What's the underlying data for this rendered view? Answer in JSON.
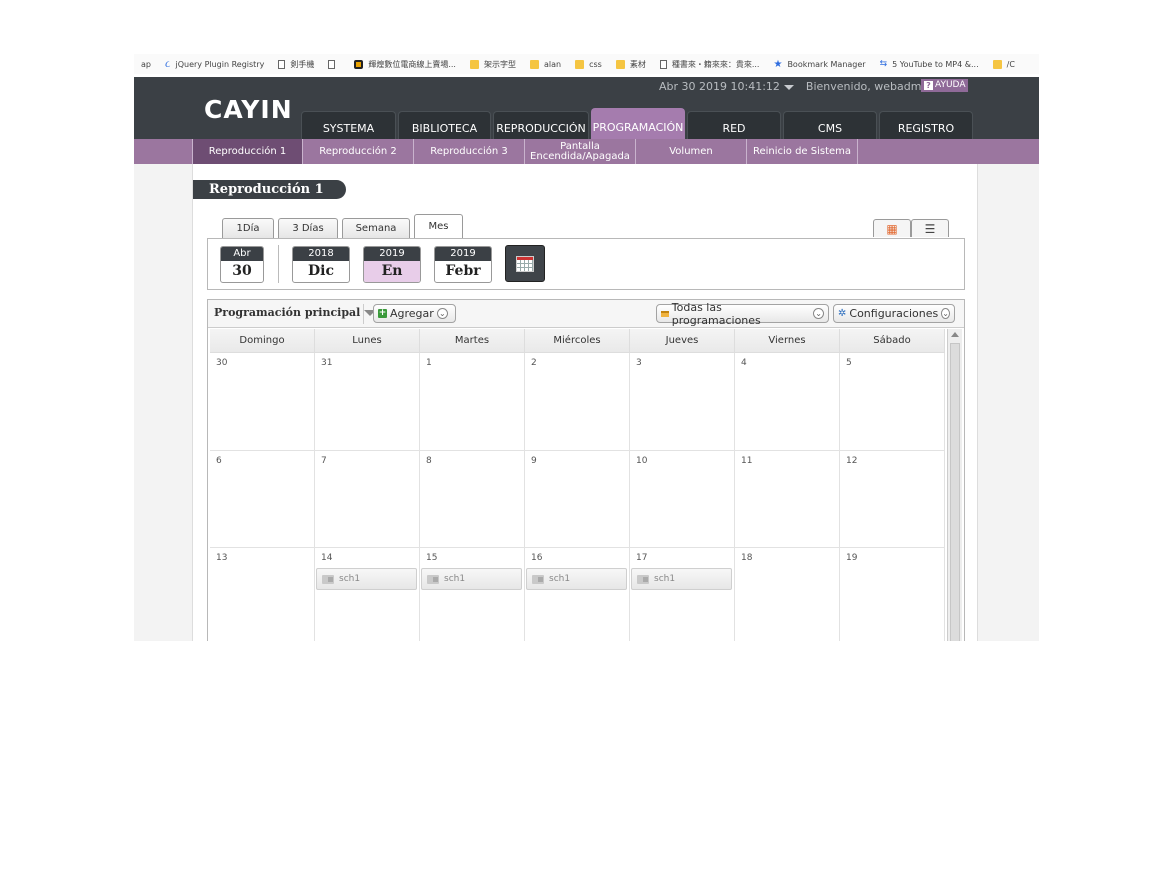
{
  "bookmarks": [
    {
      "label": "ap",
      "icon": "empty"
    },
    {
      "label": "jQuery Plugin Registry",
      "icon": "swirl-icon"
    },
    {
      "label": "剣手機",
      "icon": "page-icon"
    },
    {
      "label": "",
      "icon": "page-icon"
    },
    {
      "label": "輝煌數位電商線上賣場...",
      "icon": "logo-icon"
    },
    {
      "label": "架示字型",
      "icon": "folder-icon"
    },
    {
      "label": "alan",
      "icon": "folder-icon"
    },
    {
      "label": "css",
      "icon": "folder-icon"
    },
    {
      "label": "素材",
      "icon": "folder-icon"
    },
    {
      "label": "種書來・籍來來：貴來...",
      "icon": "page-icon"
    },
    {
      "label": "Bookmark Manager",
      "icon": "star-icon"
    },
    {
      "label": "5 YouTube to MP4 &...",
      "icon": "youtube-icon"
    },
    {
      "label": "/C",
      "icon": "folder-icon"
    }
  ],
  "header": {
    "logo": "CAYIN",
    "datetime": "Abr 30 2019 10:41:12",
    "welcome": "Bienvenido, webadmin",
    "help": "AYUDA",
    "help_icon": "?"
  },
  "main_tabs": [
    "SYSTEMA",
    "BIBLIOTECA",
    "REPRODUCCIÓN",
    "PROGRAMACIÓN",
    "RED",
    "CMS",
    "REGISTRO"
  ],
  "main_tab_active": "PROGRAMACIÓN",
  "sub_tabs": [
    "Reproducción 1",
    "Reproducción 2",
    "Reproducción 3",
    "Pantalla Encendida/Apagada",
    "Volumen",
    "Reinicio de Sistema"
  ],
  "page_title": "Reproducción 1",
  "view_tabs": [
    "1Día",
    "3 Días",
    "Semana",
    "Mes"
  ],
  "view_active": "Mes",
  "date_nav": {
    "today": {
      "top": "Abr",
      "bottom": "30"
    },
    "prev": {
      "top": "2018",
      "bottom": "Dic"
    },
    "current": {
      "top": "2019",
      "bottom": "En"
    },
    "next": {
      "top": "2019",
      "bottom": "Febr"
    }
  },
  "toolbar": {
    "schedule": "Programación principal",
    "add": "Agregar",
    "all": "Todas las programaciones",
    "config": "Configuraciones"
  },
  "weekdays": [
    "Domingo",
    "Lunes",
    "Martes",
    "Miércoles",
    "Jueves",
    "Viernes",
    "Sábado"
  ],
  "weeks": [
    [
      "30",
      "31",
      "1",
      "2",
      "3",
      "4",
      "5"
    ],
    [
      "6",
      "7",
      "8",
      "9",
      "10",
      "11",
      "12"
    ],
    [
      "13",
      "14",
      "15",
      "16",
      "17",
      "18",
      "19"
    ]
  ],
  "events": [
    {
      "week": 2,
      "day": 1,
      "label": "sch1"
    },
    {
      "week": 2,
      "day": 2,
      "label": "sch1"
    },
    {
      "week": 2,
      "day": 3,
      "label": "sch1"
    },
    {
      "week": 2,
      "day": 4,
      "label": "sch1"
    }
  ],
  "colors": {
    "header_bg": "#3b4045",
    "accent": "#a57cae",
    "subnav_bg": "#9b769f",
    "subnav_active": "#6e4d73",
    "selected_month": "#e8cde9"
  }
}
